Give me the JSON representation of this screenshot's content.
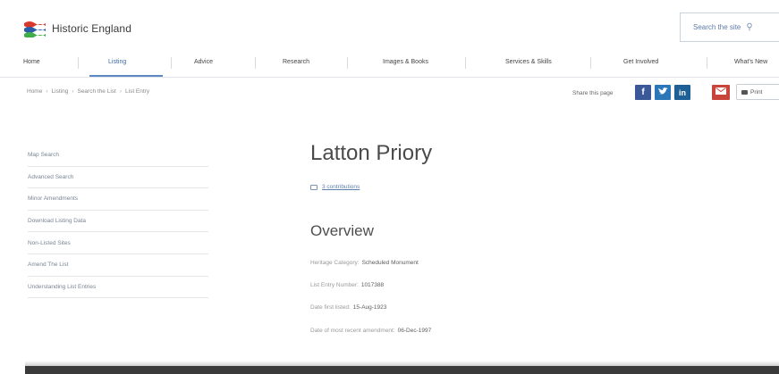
{
  "header": {
    "logo_text": "Historic England",
    "logo_icon": "historic-england-waves-logo",
    "search_placeholder": "Search the site"
  },
  "nav": {
    "items": [
      {
        "label": "Home"
      },
      {
        "label": "Listing"
      },
      {
        "label": "Advice"
      },
      {
        "label": "Research"
      },
      {
        "label": "Images & Books"
      },
      {
        "label": "Services & Skills"
      },
      {
        "label": "Get Involved"
      },
      {
        "label": "What's New"
      }
    ],
    "active": "Listing"
  },
  "breadcrumb": [
    "Home",
    "Listing",
    "Search the List",
    "List Entry"
  ],
  "share": {
    "label": "Share this page",
    "buttons": [
      {
        "icon": "facebook-icon",
        "glyph": "f",
        "color": "#3b5998"
      },
      {
        "icon": "twitter-icon",
        "glyph": "t",
        "color": "#2c77b8"
      },
      {
        "icon": "linkedin-icon",
        "glyph": "in",
        "color": "#1e5f96"
      },
      {
        "icon": "email-icon",
        "glyph": "",
        "color": "#c9453b"
      }
    ],
    "print_label": "Print"
  },
  "sidebar": {
    "items": [
      {
        "label": "Map Search"
      },
      {
        "label": "Advanced Search"
      },
      {
        "label": "Minor Amendments"
      },
      {
        "label": "Download Listing Data"
      },
      {
        "label": "Non-Listed Sites"
      },
      {
        "label": "Amend The List"
      },
      {
        "label": "Understanding List Entries"
      }
    ]
  },
  "main": {
    "title": "Latton Priory",
    "comments_link": "3 contributions",
    "overview_heading": "Overview",
    "fields": [
      {
        "label": "Heritage Category:",
        "value": "Scheduled Monument"
      },
      {
        "label": "List Entry Number:",
        "value": "1017388"
      },
      {
        "label": "Date first listed:",
        "value": "15-Aug-1923"
      },
      {
        "label": "Date of most recent amendment:",
        "value": "06-Dec-1997"
      }
    ]
  }
}
